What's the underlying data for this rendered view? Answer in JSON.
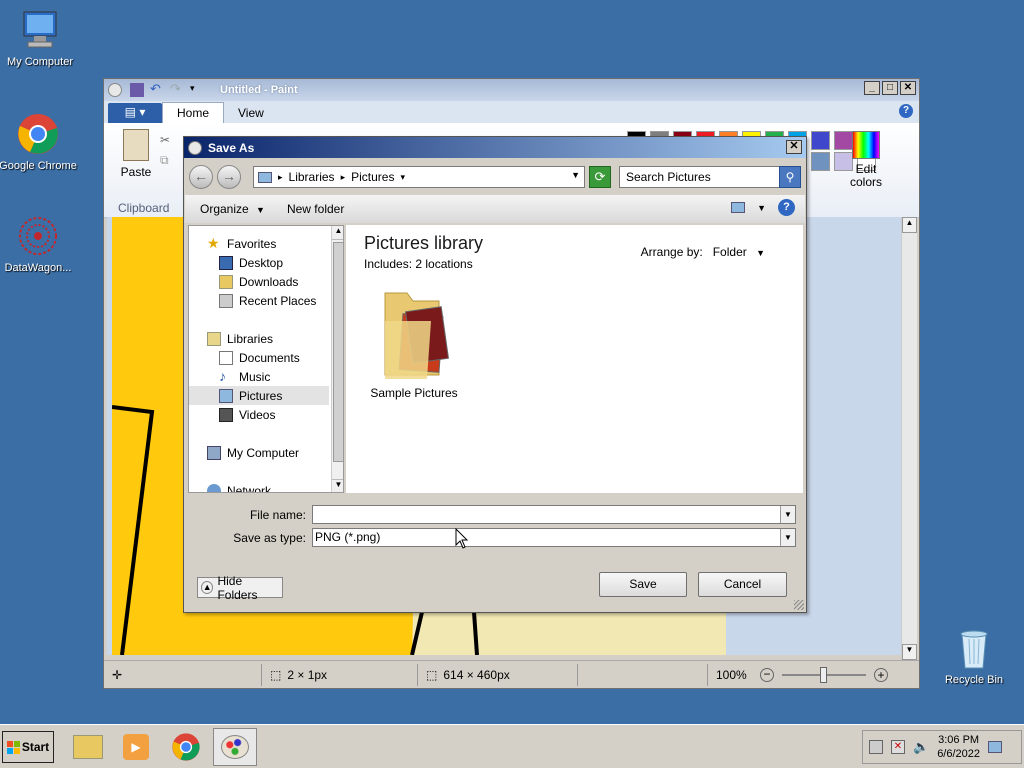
{
  "desktop": {
    "icons": [
      {
        "label": "My Computer"
      },
      {
        "label": "Google Chrome"
      },
      {
        "label": "DataWagon..."
      },
      {
        "label": "Recycle Bin"
      }
    ]
  },
  "paint": {
    "title": "Untitled - Paint",
    "tabs": {
      "home": "Home",
      "view": "View"
    },
    "clipboard": {
      "paste": "Paste",
      "group": "Clipboard"
    },
    "edit_colors": "Edit colors",
    "status": {
      "selection": "2 × 1px",
      "canvas_size": "614 × 460px",
      "zoom": "100%"
    },
    "palette": [
      "#000000",
      "#7f7f7f",
      "#880015",
      "#ed1c24",
      "#ff7f27",
      "#fff200",
      "#22b14c",
      "#00a2e8",
      "#3f48cc",
      "#a349a4",
      "#ffffff",
      "#c3c3c3",
      "#b97a57",
      "#ffaec9",
      "#ffc90e",
      "#efe4b0",
      "#b5e61d",
      "#99d9ea",
      "#7092be",
      "#c8bfe7"
    ]
  },
  "dialog": {
    "title": "Save As",
    "breadcrumb": {
      "libraries": "Libraries",
      "pictures": "Pictures"
    },
    "search_placeholder": "Search Pictures",
    "organize": "Organize",
    "new_folder": "New folder",
    "nav": {
      "favorites": "Favorites",
      "desktop": "Desktop",
      "downloads": "Downloads",
      "recent": "Recent Places",
      "libraries": "Libraries",
      "documents": "Documents",
      "music": "Music",
      "pictures": "Pictures",
      "videos": "Videos",
      "my_computer": "My Computer",
      "network": "Network"
    },
    "library_title": "Pictures library",
    "library_sub": "Includes:  2 locations",
    "arrange_label": "Arrange by:",
    "arrange_value": "Folder",
    "folder_name": "Sample Pictures",
    "file_name_label": "File name:",
    "file_name_value": "",
    "save_type_label": "Save as type:",
    "save_type_value": "PNG (*.png)",
    "save": "Save",
    "cancel": "Cancel",
    "hide_folders": "Hide Folders"
  },
  "taskbar": {
    "start": "Start",
    "time": "3:06 PM",
    "date": "6/6/2022"
  }
}
